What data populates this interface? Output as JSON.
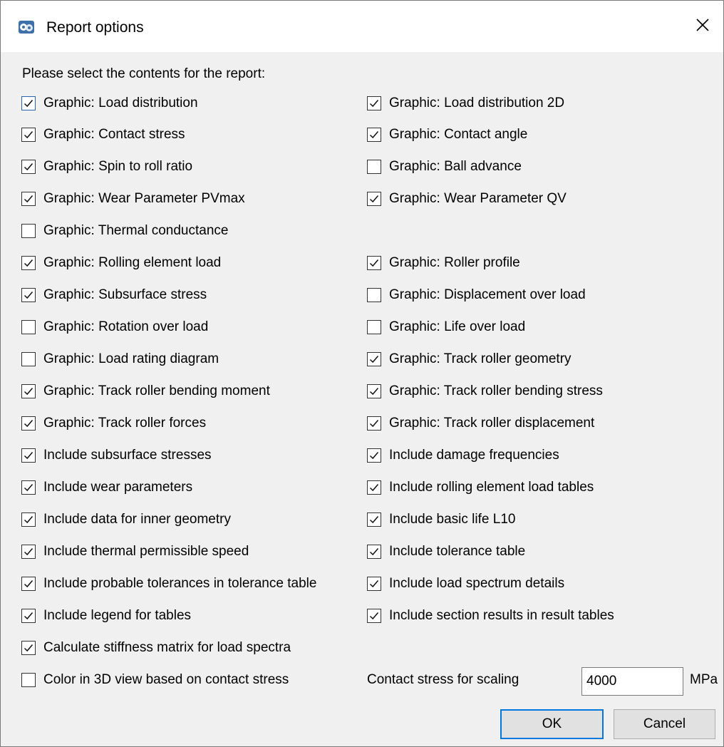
{
  "window": {
    "title": "Report options",
    "icon": "app-logo-icon",
    "close_icon": "close-icon"
  },
  "prompt": "Please select the contents for the report:",
  "checkboxes": [
    {
      "label": "Graphic: Load distribution",
      "checked": true,
      "focused": true
    },
    {
      "label": "Graphic: Load distribution 2D",
      "checked": true
    },
    {
      "label": "Graphic: Contact stress",
      "checked": true
    },
    {
      "label": "Graphic: Contact angle",
      "checked": true
    },
    {
      "label": "Graphic: Spin to roll ratio",
      "checked": true
    },
    {
      "label": "Graphic: Ball advance",
      "checked": false
    },
    {
      "label": "Graphic: Wear Parameter PVmax",
      "checked": true
    },
    {
      "label": "Graphic: Wear Parameter QV",
      "checked": true
    },
    {
      "label": "Graphic: Thermal conductance",
      "checked": false
    },
    {
      "label": "Graphic: Rolling element load",
      "checked": true
    },
    {
      "label": "Graphic: Roller profile",
      "checked": true
    },
    {
      "label": "Graphic: Subsurface stress",
      "checked": true
    },
    {
      "label": "Graphic: Displacement over load",
      "checked": false
    },
    {
      "label": "Graphic: Rotation over load",
      "checked": false
    },
    {
      "label": "Graphic: Life over load",
      "checked": false
    },
    {
      "label": "Graphic: Load rating diagram",
      "checked": false
    },
    {
      "label": "Graphic: Track roller geometry",
      "checked": true
    },
    {
      "label": "Graphic: Track roller bending moment",
      "checked": true
    },
    {
      "label": "Graphic: Track roller bending stress",
      "checked": true
    },
    {
      "label": "Graphic: Track roller forces",
      "checked": true
    },
    {
      "label": "Graphic: Track roller displacement",
      "checked": true
    },
    {
      "label": "Include subsurface stresses",
      "checked": true
    },
    {
      "label": "Include damage frequencies",
      "checked": true
    },
    {
      "label": "Include wear parameters",
      "checked": true
    },
    {
      "label": "Include rolling element load tables",
      "checked": true
    },
    {
      "label": "Include data for inner geometry",
      "checked": true
    },
    {
      "label": "Include basic life L10",
      "checked": true
    },
    {
      "label": "Include thermal permissible speed",
      "checked": true
    },
    {
      "label": "Include tolerance table",
      "checked": true
    },
    {
      "label": "Include probable tolerances in tolerance table",
      "checked": true
    },
    {
      "label": "Include load spectrum details",
      "checked": true
    },
    {
      "label": "Include legend for tables",
      "checked": true
    },
    {
      "label": "Include section results in result tables",
      "checked": true
    },
    {
      "label": "Calculate stiffness matrix for load spectra",
      "checked": true
    },
    {
      "label": "Color in 3D view based on contact stress",
      "checked": false
    }
  ],
  "contact_stress": {
    "label": "Contact stress for scaling",
    "value": "4000",
    "unit": "MPa"
  },
  "buttons": {
    "ok": "OK",
    "cancel": "Cancel"
  },
  "colors": {
    "focus_border": "#2a63b0",
    "default_button_border": "#0078d7"
  }
}
